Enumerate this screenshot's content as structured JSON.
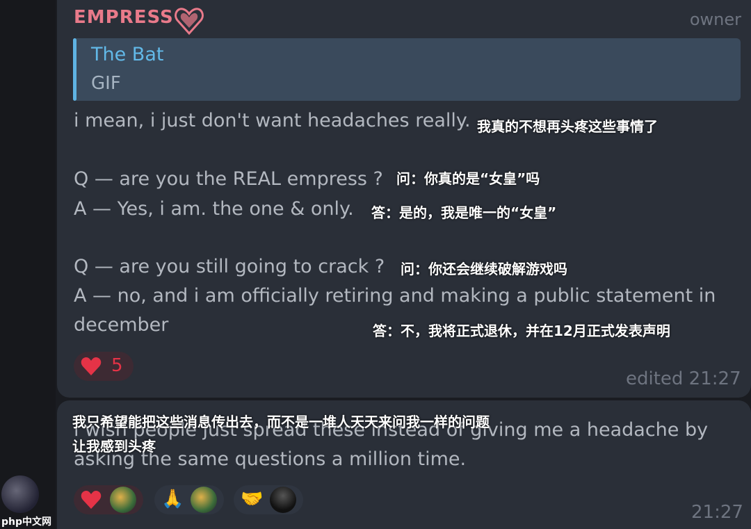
{
  "message1": {
    "sender": "EMPRESS",
    "role": "owner",
    "reply": {
      "name": "The Bat",
      "type": "GIF"
    },
    "lines": [
      "i mean, i just don't want headaches really.",
      "Q — are you the REAL empress ?",
      "A — Yes, i am. the one & only.",
      "Q — are you still going to crack ?",
      "A — no, and i am officially retiring and making a public statement in",
      "december"
    ],
    "translations": [
      "我真的不想再头疼这些事情了",
      "问：你真的是“女皇”吗",
      "答：是的，我是唯一的“女皇”",
      "问：你还会继续破解游戏吗",
      "答：不，我将正式退休，并在12月正式发表声明"
    ],
    "reaction": {
      "icon": "heart-icon",
      "count": "5"
    },
    "time": "edited 21:27"
  },
  "message2": {
    "lines": [
      "i wish people just spread these instead of giving me a headache by",
      "asking the same questions a million time."
    ],
    "translations": [
      "我只希望能把这些消息传出去，而不是一堆人天天来问我一样的问题",
      "让我感到头疼"
    ],
    "reactions": [
      {
        "icon": "heart-icon"
      },
      {
        "icon": "pray-icon"
      },
      {
        "icon": "handshake-icon"
      }
    ],
    "time": "21:27"
  },
  "watermark": "php中文网",
  "colors": {
    "bubble": "#2a2f38",
    "accent": "#62b9e8",
    "sender": "#e97a8a",
    "heart": "#e53347"
  }
}
